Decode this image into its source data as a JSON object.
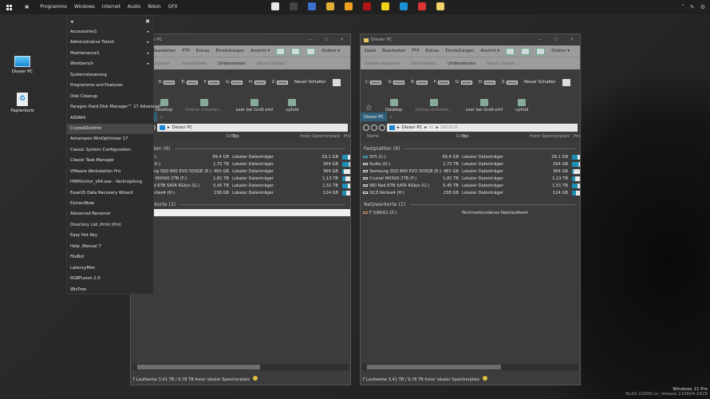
{
  "topbar": {
    "items": [
      "Programme",
      "Windows",
      "Internet",
      "Audio",
      "Nikon",
      "GFX"
    ],
    "apps": [
      {
        "name": "alien-icon",
        "color": "#e8e8e8"
      },
      {
        "name": "steam-icon",
        "color": "#444"
      },
      {
        "name": "remote-desktop-icon",
        "color": "#3a6fd0"
      },
      {
        "name": "chrome-icon",
        "color": "#e0b030"
      },
      {
        "name": "vmware-icon",
        "color": "#f0a020"
      },
      {
        "name": "red-app-icon",
        "color": "#b01818"
      },
      {
        "name": "sticky-notes-icon",
        "color": "#f3d21c"
      },
      {
        "name": "edge-icon",
        "color": "#1a8fd8"
      },
      {
        "name": "flag-app-icon",
        "color": "#d33"
      },
      {
        "name": "weather-icon",
        "color": "#f1d36a"
      }
    ]
  },
  "desktop": {
    "icons": [
      {
        "label": "Dieser PC"
      },
      {
        "label": "Papierkorb"
      }
    ]
  },
  "menu": {
    "items": [
      {
        "label": "Accessories1",
        "sub": true
      },
      {
        "label": "Administrative Tools1",
        "sub": true
      },
      {
        "label": "Maintenance1",
        "sub": true
      },
      {
        "label": "Workbench",
        "sub": true
      },
      {
        "label": "Systemsteuerung"
      },
      {
        "label": "Programme und Features"
      },
      {
        "label": "Disk Cleanup"
      },
      {
        "label": "Paragon Hard Disk Manager™ 17 Advanced"
      },
      {
        "label": "AIDA64"
      },
      {
        "label": "CrystalDiskInfo",
        "selected": true
      },
      {
        "label": "Ashampoo WinOptimizer 17"
      },
      {
        "label": "Classic System Configuration"
      },
      {
        "label": "Classic Task Manager"
      },
      {
        "label": "VMware Workstation Pro"
      },
      {
        "label": "HWMonitor_x64.exe - Verknüpfung"
      },
      {
        "label": "EaseUS Data Recovery Wizard"
      },
      {
        "label": "ExtractNow"
      },
      {
        "label": "Advanced Renamer"
      },
      {
        "label": "Directory List ,Print (Pro)"
      },
      {
        "label": "Easy Hot Key"
      },
      {
        "label": "Help ,Manual 7"
      },
      {
        "label": "FileBot"
      },
      {
        "label": "LatencyMon"
      },
      {
        "label": "RGBFusion 2.0"
      },
      {
        "label": "WizTree"
      }
    ]
  },
  "windows": [
    {
      "title": "Dieser PC",
      "address": [
        "Dieser PC"
      ],
      "selected_network_row": true
    },
    {
      "title": "Dieser PC",
      "address": [
        "Dieser PC",
        "H:",
        "BACKUP"
      ],
      "selected_network_row": false
    }
  ],
  "explorer": {
    "menubar": [
      "Datei",
      "Bearbeiten",
      "FTP",
      "Extras",
      "Einstellungen",
      "Ansicht ▾",
      "Ordner ▾"
    ],
    "tools": [
      "Dateien kopieren",
      "Verschieben",
      "Umbenennen",
      "Neuer Ordner"
    ],
    "drives": [
      "C:",
      "D:",
      "E:",
      "F:",
      "G:",
      "H:",
      "Z:"
    ],
    "new_button": "Neuer Schalter",
    "buttons": [
      "Desktop",
      "Ordner erstellen...",
      "Leer bei Groß einf",
      "upfold"
    ],
    "tab": "Dieser PC",
    "columns": [
      "Name",
      "Größe",
      "Typ",
      "freier Speicherplatz",
      "Pro"
    ],
    "group_drives": "Festplatten (6)",
    "group_network": "Netzwerkorte (1)",
    "rows": [
      {
        "name": "SYS (C:)",
        "size": "99,4 GB",
        "type": "Lokaler Datenträger",
        "free": "29,1 GB",
        "used": 0.71
      },
      {
        "name": "Audio (D:)",
        "size": "1,72 TB",
        "type": "Lokaler Datenträger",
        "free": "264 GB",
        "used": 0.85
      },
      {
        "name": "Samsung SSD 840 EVO 500GB (E:)",
        "size": "465 GB",
        "type": "Lokaler Datenträger",
        "free": "364 GB",
        "used": 0.22
      },
      {
        "name": "Crucial MX500 2TB (F:)",
        "size": "1,81 TB",
        "type": "Lokaler Datenträger",
        "free": "1,13 TB",
        "used": 0.38
      },
      {
        "name": "WD Red 6TB SATA 6Gb/s (G:)",
        "size": "5,45 TB",
        "type": "Lokaler Datenträger",
        "free": "1,51 TB",
        "used": 0.72
      },
      {
        "name": "OCZ-Vertex4 (H:)",
        "size": "238 GB",
        "type": "Lokaler Datenträger",
        "free": "124 GB",
        "used": 0.48
      }
    ],
    "network": {
      "name": "F (\\\\NUC) (Z:)",
      "type": "Nichtverbundenes Netzlaufwerk"
    },
    "status": "7 Laufwerke  3,41 TB / 9,78 TB freier lokaler Speicherplatz"
  },
  "os": {
    "edition": "Windows 11 Pro",
    "build": "Build 22000.co_release.210604-1628"
  },
  "colors": {
    "accent": "#1e8fb7",
    "selection": "#2f5f7a"
  }
}
